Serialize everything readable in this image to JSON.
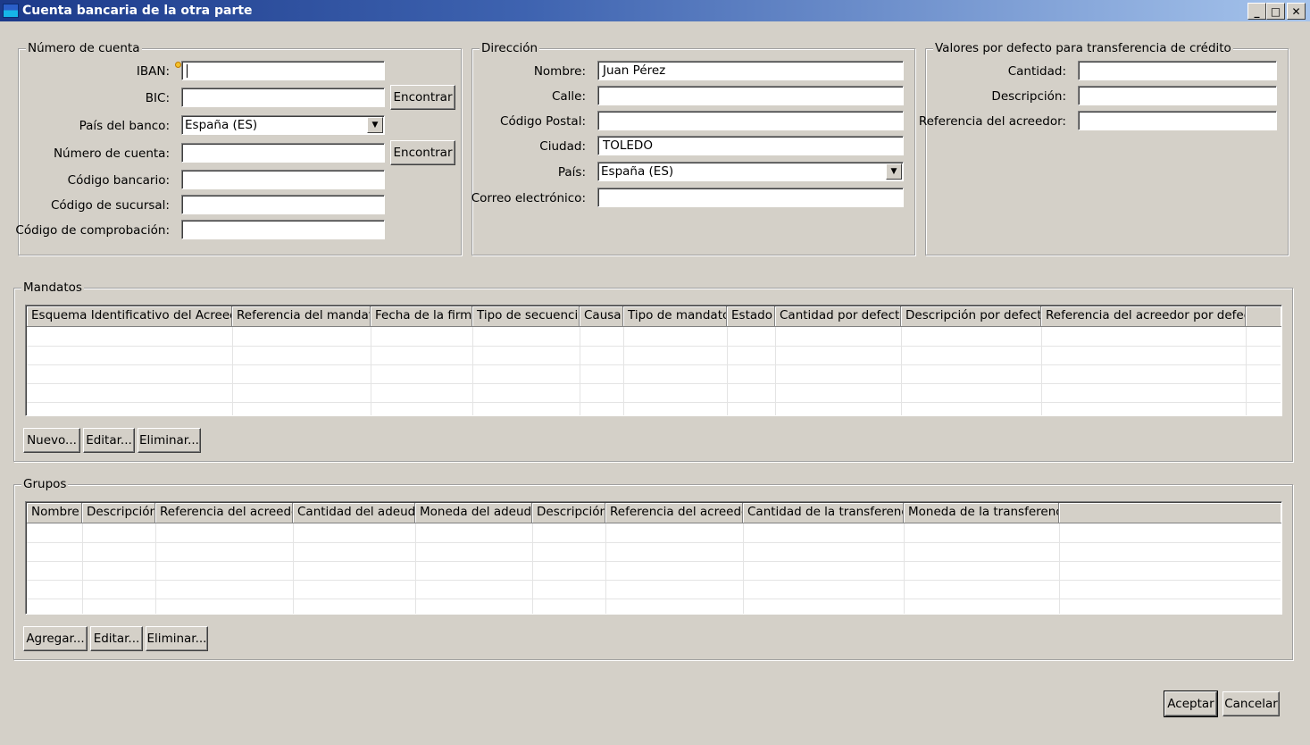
{
  "window": {
    "title": "Cuenta bancaria de la otra parte",
    "minimize_glyph": "_",
    "maximize_glyph": "□",
    "close_glyph": "✕"
  },
  "account": {
    "legend": "Número de cuenta",
    "iban_label": "IBAN:",
    "iban_value": "",
    "bic_label": "BIC:",
    "bic_value": "",
    "find_label": "Encontrar",
    "country_label": "País del banco:",
    "country_value": "España (ES)",
    "account_number_label": "Número de cuenta:",
    "account_number_value": "",
    "bank_code_label": "Código bancario:",
    "bank_code_value": "",
    "branch_code_label": "Código de sucursal:",
    "branch_code_value": "",
    "check_code_label": "Código de comprobación:",
    "check_code_value": ""
  },
  "address": {
    "legend": "Dirección",
    "name_label": "Nombre:",
    "name_value": "Juan Pérez",
    "street_label": "Calle:",
    "street_value": "",
    "postal_label": "Código Postal:",
    "postal_value": "",
    "city_label": "Ciudad:",
    "city_value": "TOLEDO",
    "country_label": "País:",
    "country_value": "España (ES)",
    "email_label": "Correo electrónico:",
    "email_value": ""
  },
  "defaults": {
    "legend": "Valores por defecto para transferencia de crédito",
    "amount_label": "Cantidad:",
    "amount_value": "",
    "description_label": "Descripción:",
    "description_value": "",
    "creditor_ref_label": "Referencia del acreedor:",
    "creditor_ref_value": ""
  },
  "mandates": {
    "legend": "Mandatos",
    "columns": [
      "Esquema Identificativo del Acreedor",
      "Referencia del mandato",
      "Fecha de la firma",
      "Tipo de secuencia",
      "Causa",
      "Tipo de mandato",
      "Estado",
      "Cantidad por defecto",
      "Descripción por defecto",
      "Referencia del acreedor por defecto"
    ],
    "new_label": "Nuevo...",
    "edit_label": "Editar...",
    "delete_label": "Eliminar..."
  },
  "groups": {
    "legend": "Grupos",
    "columns": [
      "Nombre",
      "Descripción",
      "Referencia del acreedor",
      "Cantidad del adeudo",
      "Moneda del adeudo",
      "Descripción",
      "Referencia del acreedor",
      "Cantidad de la transferencia",
      "Moneda de la transferencia"
    ],
    "add_label": "Agregar...",
    "edit_label": "Editar...",
    "delete_label": "Eliminar..."
  },
  "footer": {
    "accept_label": "Aceptar",
    "cancel_label": "Cancelar"
  },
  "icons": {
    "window_icon": "app-window-icon",
    "warning": "warning-icon",
    "dropdown": "chevron-down-icon"
  },
  "colors": {
    "titlebar_start": "#1c3a8a",
    "titlebar_end": "#a6c4ec",
    "dialog_bg": "#d4d0c8"
  }
}
